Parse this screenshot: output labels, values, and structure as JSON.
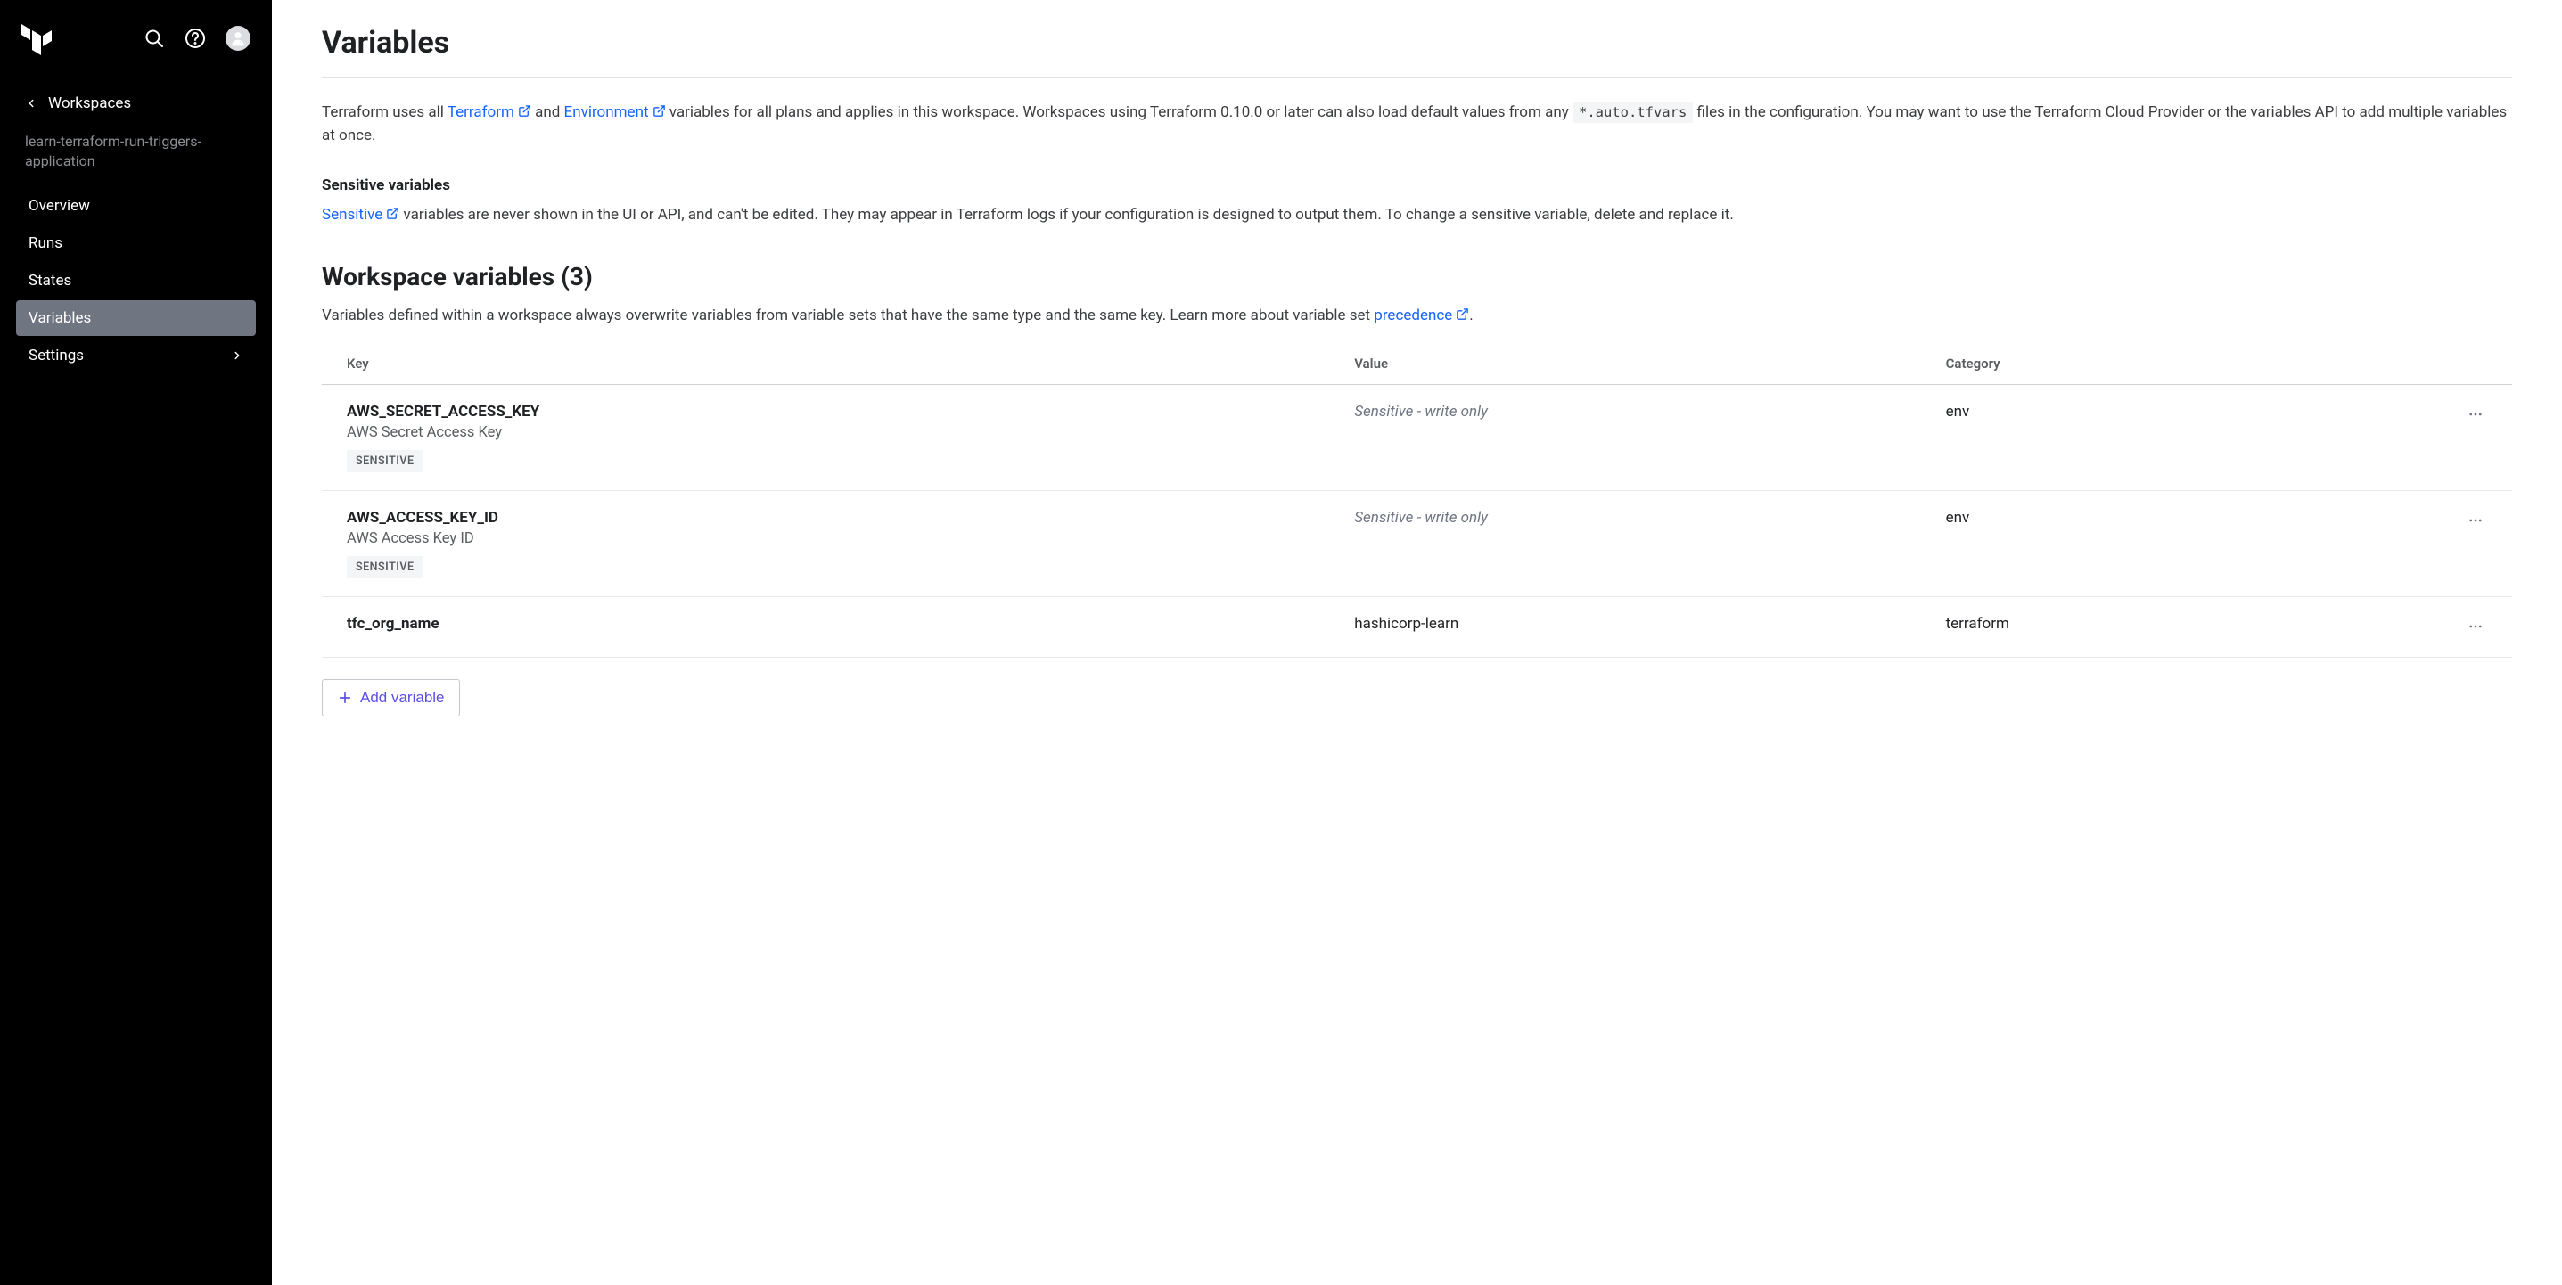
{
  "sidebar": {
    "back_label": "Workspaces",
    "workspace_name": "learn-terraform-run-triggers-application",
    "items": [
      {
        "label": "Overview",
        "active": false,
        "has_chevron": false
      },
      {
        "label": "Runs",
        "active": false,
        "has_chevron": false
      },
      {
        "label": "States",
        "active": false,
        "has_chevron": false
      },
      {
        "label": "Variables",
        "active": true,
        "has_chevron": false
      },
      {
        "label": "Settings",
        "active": false,
        "has_chevron": true
      }
    ]
  },
  "main": {
    "title": "Variables",
    "intro": {
      "pre": "Terraform uses all ",
      "link1": "Terraform",
      "and": " and ",
      "link2": "Environment",
      "mid": " variables for all plans and applies in this workspace. Workspaces using Terraform 0.10.0 or later can also load default values from any ",
      "code": "*.auto.tfvars",
      "post": " files in the configuration. You may want to use the Terraform Cloud Provider or the variables API to add multiple variables at once."
    },
    "sensitive": {
      "heading": "Sensitive variables",
      "link": "Sensitive",
      "text": " variables are never shown in the UI or API, and can't be edited. They may appear in Terraform logs if your configuration is designed to output them. To change a sensitive variable, delete and replace it."
    },
    "workspace_vars": {
      "title_prefix": "Workspace variables (",
      "count": "3",
      "title_suffix": ")",
      "desc_pre": "Variables defined within a workspace always overwrite variables from variable sets that have the same type and the same key. Learn more about variable set ",
      "desc_link": "precedence",
      "desc_post": "."
    },
    "table": {
      "headers": {
        "key": "Key",
        "value": "Value",
        "category": "Category"
      },
      "rows": [
        {
          "key": "AWS_SECRET_ACCESS_KEY",
          "desc": "AWS Secret Access Key",
          "sensitive": true,
          "value": "Sensitive - write only",
          "category": "env",
          "sensitive_badge": "SENSITIVE"
        },
        {
          "key": "AWS_ACCESS_KEY_ID",
          "desc": "AWS Access Key ID",
          "sensitive": true,
          "value": "Sensitive - write only",
          "category": "env",
          "sensitive_badge": "SENSITIVE"
        },
        {
          "key": "tfc_org_name",
          "desc": "",
          "sensitive": false,
          "value": "hashicorp-learn",
          "category": "terraform",
          "sensitive_badge": ""
        }
      ]
    },
    "add_button": "Add variable"
  }
}
